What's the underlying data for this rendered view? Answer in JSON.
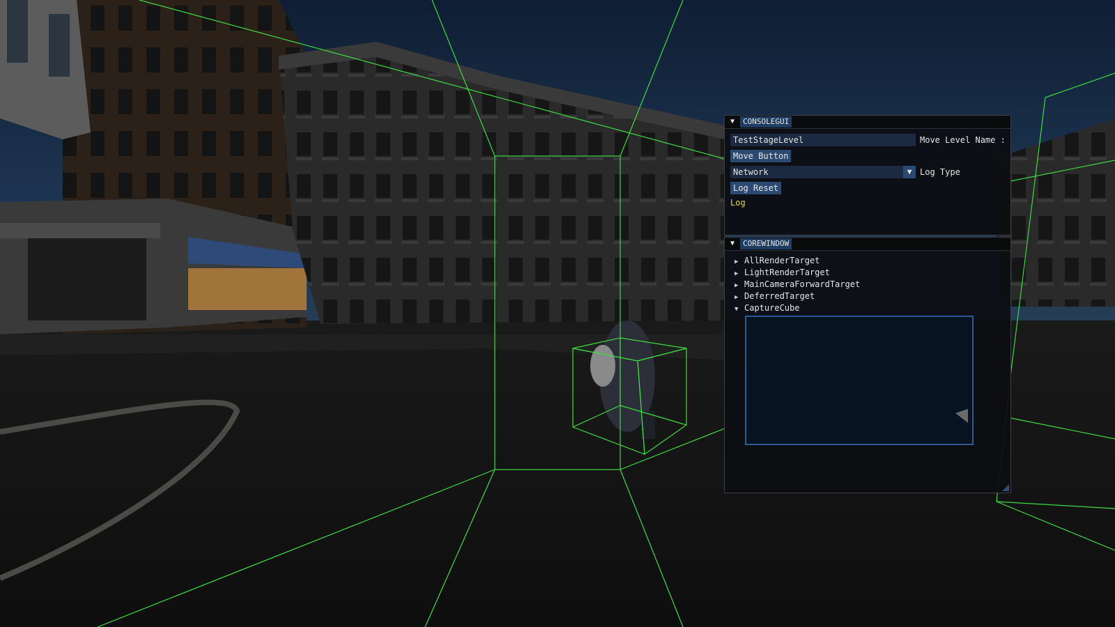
{
  "console_gui": {
    "title": "CONSOLEGUI",
    "level_name_value": "TestStageLevel",
    "level_name_label": "Move Level Name :",
    "move_button_label": "Move Button",
    "log_type_selected": "Network",
    "log_type_label": "Log Type",
    "log_reset_label": "Log Reset",
    "log_text": "Log",
    "collapse_icon": "collapse-triangle-icon"
  },
  "core_window": {
    "title": "COREWINDOW",
    "collapse_icon": "collapse-triangle-icon",
    "tree_items": [
      {
        "label": "AllRenderTarget",
        "expanded": false
      },
      {
        "label": "LightRenderTarget",
        "expanded": false
      },
      {
        "label": "MainCameraForwardTarget",
        "expanded": false
      },
      {
        "label": "DeferredTarget",
        "expanded": false
      },
      {
        "label": "CaptureCube",
        "expanded": true
      }
    ]
  },
  "colors": {
    "wireframe": "#3ddc3d",
    "title_tab": "#1f3d63",
    "button": "#2a4a72",
    "input_bg": "#1b2a40",
    "log_text": "#e8d44a"
  }
}
